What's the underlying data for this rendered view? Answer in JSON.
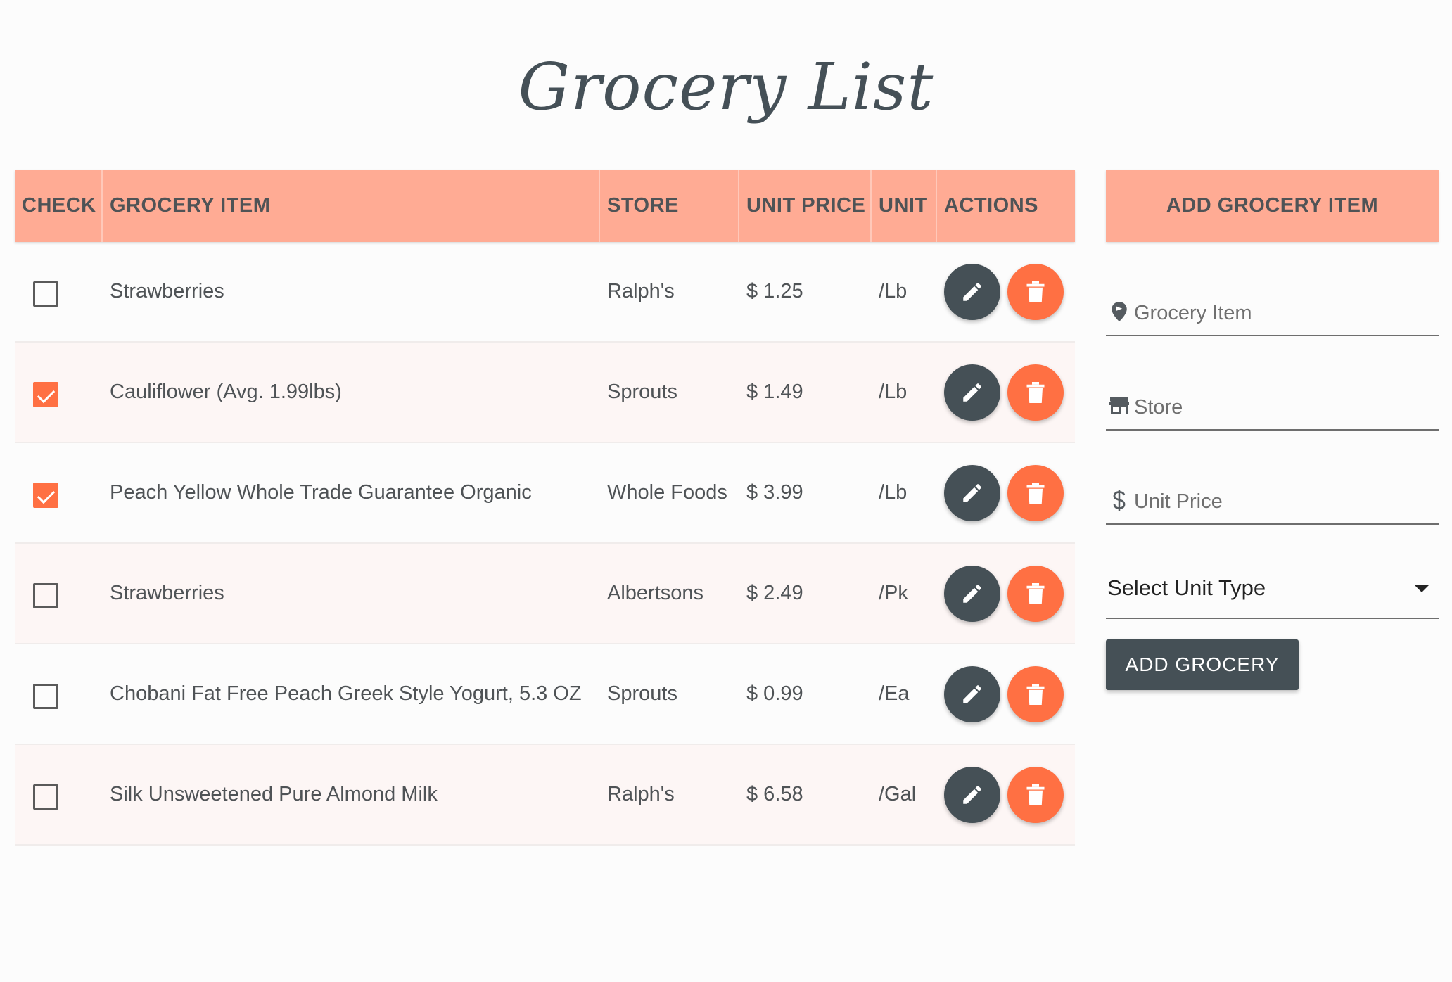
{
  "title": "Grocery List",
  "colors": {
    "header_bg": "#ffab94",
    "accent": "#ff7043",
    "dark": "#455056",
    "row_alt": "#fdf6f5"
  },
  "table": {
    "headers": {
      "check": "CHECK",
      "item": "GROCERY ITEM",
      "store": "STORE",
      "unit_price": "UNIT PRICE",
      "unit": "UNIT",
      "actions": "ACTIONS"
    },
    "rows": [
      {
        "checked": false,
        "item": "Strawberries",
        "store": "Ralph's",
        "price": "$ 1.25",
        "unit": "/Lb"
      },
      {
        "checked": true,
        "item": "Cauliflower (Avg. 1.99lbs)",
        "store": "Sprouts",
        "price": "$ 1.49",
        "unit": "/Lb"
      },
      {
        "checked": true,
        "item": "Peach Yellow Whole Trade Guarantee Organic",
        "store": "Whole Foods",
        "price": "$ 3.99",
        "unit": "/Lb"
      },
      {
        "checked": false,
        "item": "Strawberries",
        "store": "Albertsons",
        "price": "$ 2.49",
        "unit": "/Pk"
      },
      {
        "checked": false,
        "item": "Chobani Fat Free Peach Greek Style Yogurt, 5.3 OZ",
        "store": "Sprouts",
        "price": "$ 0.99",
        "unit": "/Ea"
      },
      {
        "checked": false,
        "item": "Silk Unsweetened Pure Almond Milk",
        "store": "Ralph's",
        "price": "$ 6.58",
        "unit": "/Gal"
      }
    ],
    "action_icons": {
      "edit": "pencil-icon",
      "delete": "trash-icon"
    }
  },
  "form": {
    "header": "ADD GROCERY ITEM",
    "item_placeholder": "Grocery Item",
    "item_icon": "map-pin-icon",
    "store_placeholder": "Store",
    "store_icon": "store-icon",
    "price_placeholder": "Unit Price",
    "price_icon": "dollar-icon",
    "unit_select": "Select Unit Type",
    "submit_label": "ADD GROCERY"
  }
}
